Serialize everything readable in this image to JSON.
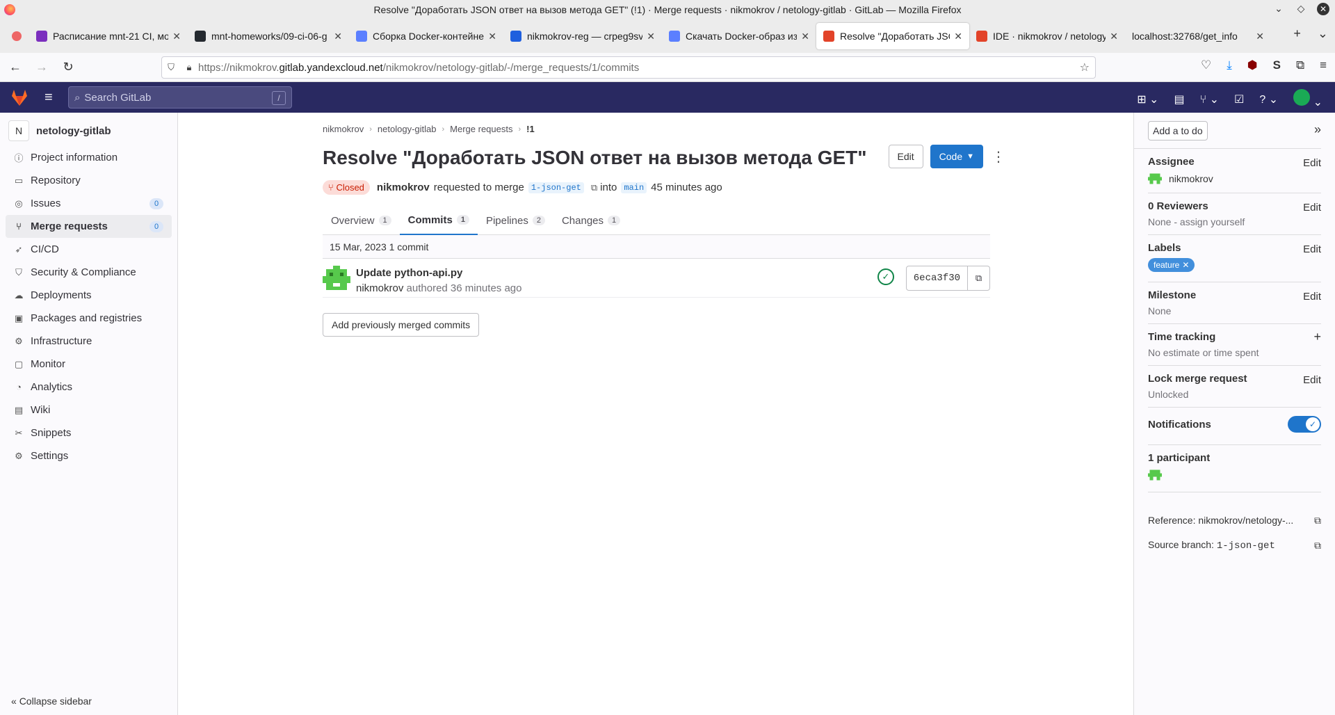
{
  "browser": {
    "window_title": "Resolve \"Доработать JSON ответ на вызов метода GET\" (!1) · Merge requests · nikmokrov / netology-gitlab · GitLab — Mozilla Firefox",
    "tabs": [
      {
        "title": "Расписание mnt-21 CI, мо",
        "icon": "calendar-favicon",
        "color": "#7b2fbe"
      },
      {
        "title": "mnt-homeworks/09-ci-06-g",
        "icon": "github-favicon",
        "color": "#24292f"
      },
      {
        "title": "Сборка Docker-контейнер",
        "icon": "doc-favicon",
        "color": "#5b7fff"
      },
      {
        "title": "nikmokrov-reg — crpeg9sv",
        "icon": "yandex-cloud-favicon",
        "color": "#1f5fde"
      },
      {
        "title": "Скачать Docker-образ из р",
        "icon": "doc-favicon",
        "color": "#5b7fff"
      },
      {
        "title": "Resolve \"Доработать JSON",
        "icon": "gitlab-favicon",
        "color": "#e24329"
      },
      {
        "title": "IDE · nikmokrov / netology",
        "icon": "gitlab-favicon",
        "color": "#e24329"
      },
      {
        "title": "localhost:32768/get_info",
        "icon": "",
        "color": ""
      }
    ],
    "url_prefix": "https://nikmokrov.",
    "url_host": "gitlab.yandexcloud.net",
    "url_path": "/nikmokrov/netology-gitlab/-/merge_requests/1/commits"
  },
  "gitlab": {
    "search_placeholder": "Search GitLab",
    "search_shortcut": "/"
  },
  "sidebar": {
    "project_initial": "N",
    "project_name": "netology-gitlab",
    "items": [
      {
        "label": "Project information",
        "icon": "info-icon",
        "glyph": "ⓘ"
      },
      {
        "label": "Repository",
        "icon": "book-icon",
        "glyph": "▭"
      },
      {
        "label": "Issues",
        "icon": "issues-icon",
        "glyph": "◎",
        "badge": "0"
      },
      {
        "label": "Merge requests",
        "icon": "merge-request-icon",
        "glyph": "⑂",
        "badge": "0"
      },
      {
        "label": "CI/CD",
        "icon": "rocket-icon",
        "glyph": "➶"
      },
      {
        "label": "Security & Compliance",
        "icon": "shield-icon",
        "glyph": "⛉"
      },
      {
        "label": "Deployments",
        "icon": "deployments-icon",
        "glyph": "☁"
      },
      {
        "label": "Packages and registries",
        "icon": "package-icon",
        "glyph": "▣"
      },
      {
        "label": "Infrastructure",
        "icon": "infrastructure-icon",
        "glyph": "⚙"
      },
      {
        "label": "Monitor",
        "icon": "monitor-icon",
        "glyph": "▢"
      },
      {
        "label": "Analytics",
        "icon": "chart-icon",
        "glyph": "◔"
      },
      {
        "label": "Wiki",
        "icon": "wiki-icon",
        "glyph": "▤"
      },
      {
        "label": "Snippets",
        "icon": "snippet-icon",
        "glyph": "✂"
      },
      {
        "label": "Settings",
        "icon": "gear-icon",
        "glyph": "⚙"
      }
    ],
    "collapse_label": "Collapse sidebar"
  },
  "main": {
    "breadcrumb": [
      "nikmokrov",
      "netology-gitlab",
      "Merge requests",
      "!1"
    ],
    "title": "Resolve \"Доработать JSON ответ на вызов метода GET\"",
    "edit_label": "Edit",
    "code_label": "Code",
    "status": "Closed",
    "author": "nikmokrov",
    "requested_text": "requested to merge",
    "source_branch": "1-json-get",
    "into_text": "into",
    "target_branch": "main",
    "time_ago": "45 minutes ago",
    "tabs": [
      {
        "label": "Overview",
        "count": "1"
      },
      {
        "label": "Commits",
        "count": "1"
      },
      {
        "label": "Pipelines",
        "count": "2"
      },
      {
        "label": "Changes",
        "count": "1"
      }
    ],
    "active_tab": "Commits",
    "day_header": "15 Mar, 2023 1 commit",
    "commit": {
      "title": "Update python-api.py",
      "author": "nikmokrov",
      "authored_text": "authored 36 minutes ago",
      "sha": "6eca3f30",
      "pipeline_status": "passed"
    },
    "add_merged_label": "Add previously merged commits"
  },
  "right_sidebar": {
    "todo_label": "Add a to do",
    "assignee_label": "Assignee",
    "assignee_value": "nikmokrov",
    "reviewers_label": "0 Reviewers",
    "reviewers_value": "None - assign yourself",
    "labels_label": "Labels",
    "label_chip": "feature",
    "milestone_label": "Milestone",
    "milestone_value": "None",
    "time_label": "Time tracking",
    "time_value": "No estimate or time spent",
    "lock_label": "Lock merge request",
    "lock_value": "Unlocked",
    "notifications_label": "Notifications",
    "notifications_on": true,
    "participants_label": "1 participant",
    "reference_text": "Reference: nikmokrov/netology-...",
    "source_branch_label": "Source branch: ",
    "source_branch_value": "1-json-get",
    "edit_label": "Edit"
  },
  "colors": {
    "gitlab_top": "#292961",
    "accent": "#1f75cb",
    "closed_bg": "#fcdcd8",
    "closed_fg": "#c91c00",
    "pipeline_ok": "#108548"
  }
}
